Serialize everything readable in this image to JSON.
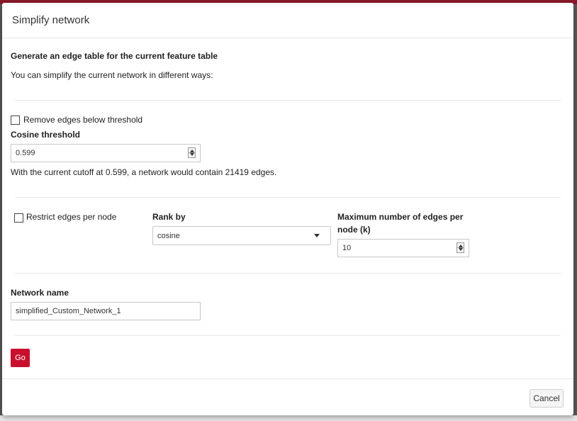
{
  "dialog": {
    "title": "Simplify network"
  },
  "intro": {
    "heading": "Generate an edge table for the current feature table",
    "description": "You can simplify the current network in different ways:"
  },
  "threshold": {
    "checkbox_label": "Remove edges below threshold",
    "checked": false,
    "field_label": "Cosine threshold",
    "value": "0.599",
    "info": "With the current cutoff at 0.599, a network would contain 21419 edges."
  },
  "restrict": {
    "checkbox_label": "Restrict edges per node",
    "checked": false,
    "rank_label": "Rank by",
    "rank_value": "cosine",
    "max_label_line1": "Maximum number of edges per",
    "max_label_line2": "node (k)",
    "max_value": "10"
  },
  "network": {
    "label": "Network name",
    "value": "simplified_Custom_Network_1"
  },
  "actions": {
    "go_label": "Go",
    "cancel_label": "Cancel"
  },
  "colors": {
    "accent": "#c8102e",
    "topbar": "#8c1a2b"
  },
  "icons": {
    "spinner": "number-spinner-icon",
    "dropdown": "chevron-down-icon"
  }
}
